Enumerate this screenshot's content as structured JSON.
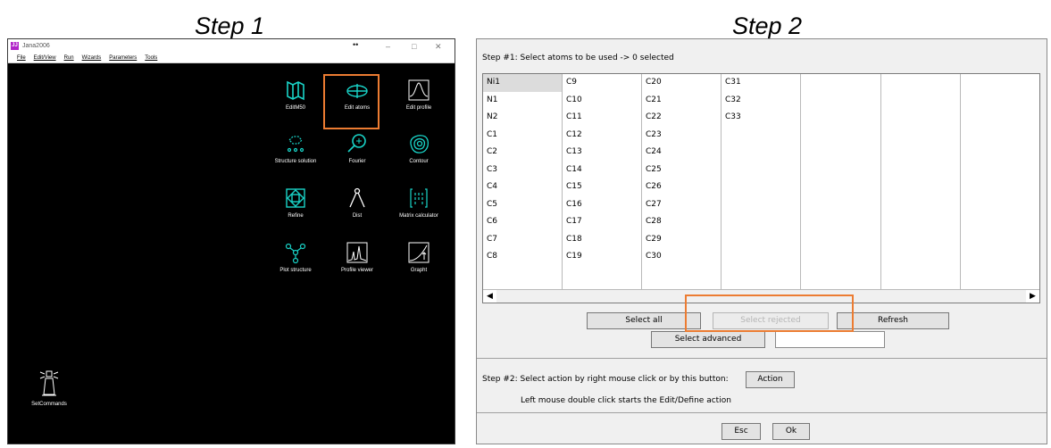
{
  "step1": {
    "caption": "Step 1",
    "window_title": "Jana2006",
    "app_icon": "JJ",
    "resize_grip": "••",
    "window_controls": {
      "minimize": "–",
      "maximize": "□",
      "close": "✕"
    },
    "menu": [
      "File",
      "Edit/View",
      "Run",
      "Wizards",
      "Parameters",
      "Tools"
    ],
    "tools": [
      {
        "label": "EditM50",
        "icon": "editm50-icon"
      },
      {
        "label": "Edit atoms",
        "icon": "edit-atoms-icon"
      },
      {
        "label": "Edit profile",
        "icon": "edit-profile-icon"
      },
      {
        "label": "Structure solution",
        "icon": "structure-solution-icon"
      },
      {
        "label": "Fourier",
        "icon": "fourier-icon"
      },
      {
        "label": "Contour",
        "icon": "contour-icon"
      },
      {
        "label": "Refine",
        "icon": "refine-icon"
      },
      {
        "label": "Dist",
        "icon": "dist-icon"
      },
      {
        "label": "Matrix calculator",
        "icon": "matrix-calculator-icon"
      },
      {
        "label": "Plot structure",
        "icon": "plot-structure-icon"
      },
      {
        "label": "Profile viewer",
        "icon": "profile-viewer-icon"
      },
      {
        "label": "Grapht",
        "icon": "grapht-icon"
      }
    ],
    "setcommands_label": "SetCommands",
    "highlight_color": "#ec7c32",
    "icon_color": "#19d4c8"
  },
  "step2": {
    "caption": "Step 2",
    "step1_label": "Step #1: Select atoms to be used  -> 0 selected",
    "columns": [
      [
        "Ni1",
        "N1",
        "N2",
        "C1",
        "C2",
        "C3",
        "C4",
        "C5",
        "C6",
        "C7",
        "C8"
      ],
      [
        "C9",
        "C10",
        "C11",
        "C12",
        "C13",
        "C14",
        "C15",
        "C16",
        "C17",
        "C18",
        "C19"
      ],
      [
        "C20",
        "C21",
        "C22",
        "C23",
        "C24",
        "C25",
        "C26",
        "C27",
        "C28",
        "C29",
        "C30"
      ],
      [
        "C31",
        "C32",
        "C33"
      ],
      [],
      [],
      []
    ],
    "buttons": {
      "select_all": "Select all",
      "select_rejected": "Select rejected",
      "refresh": "Refresh",
      "select_advanced": "Select advanced",
      "action": "Action",
      "esc": "Esc",
      "ok": "Ok"
    },
    "step2_label": "Step #2: Select action by right mouse click or by this button:",
    "double_click_hint": "Left mouse double click starts the Edit/Define action",
    "scroll_left": "◀",
    "scroll_right": "▶"
  }
}
